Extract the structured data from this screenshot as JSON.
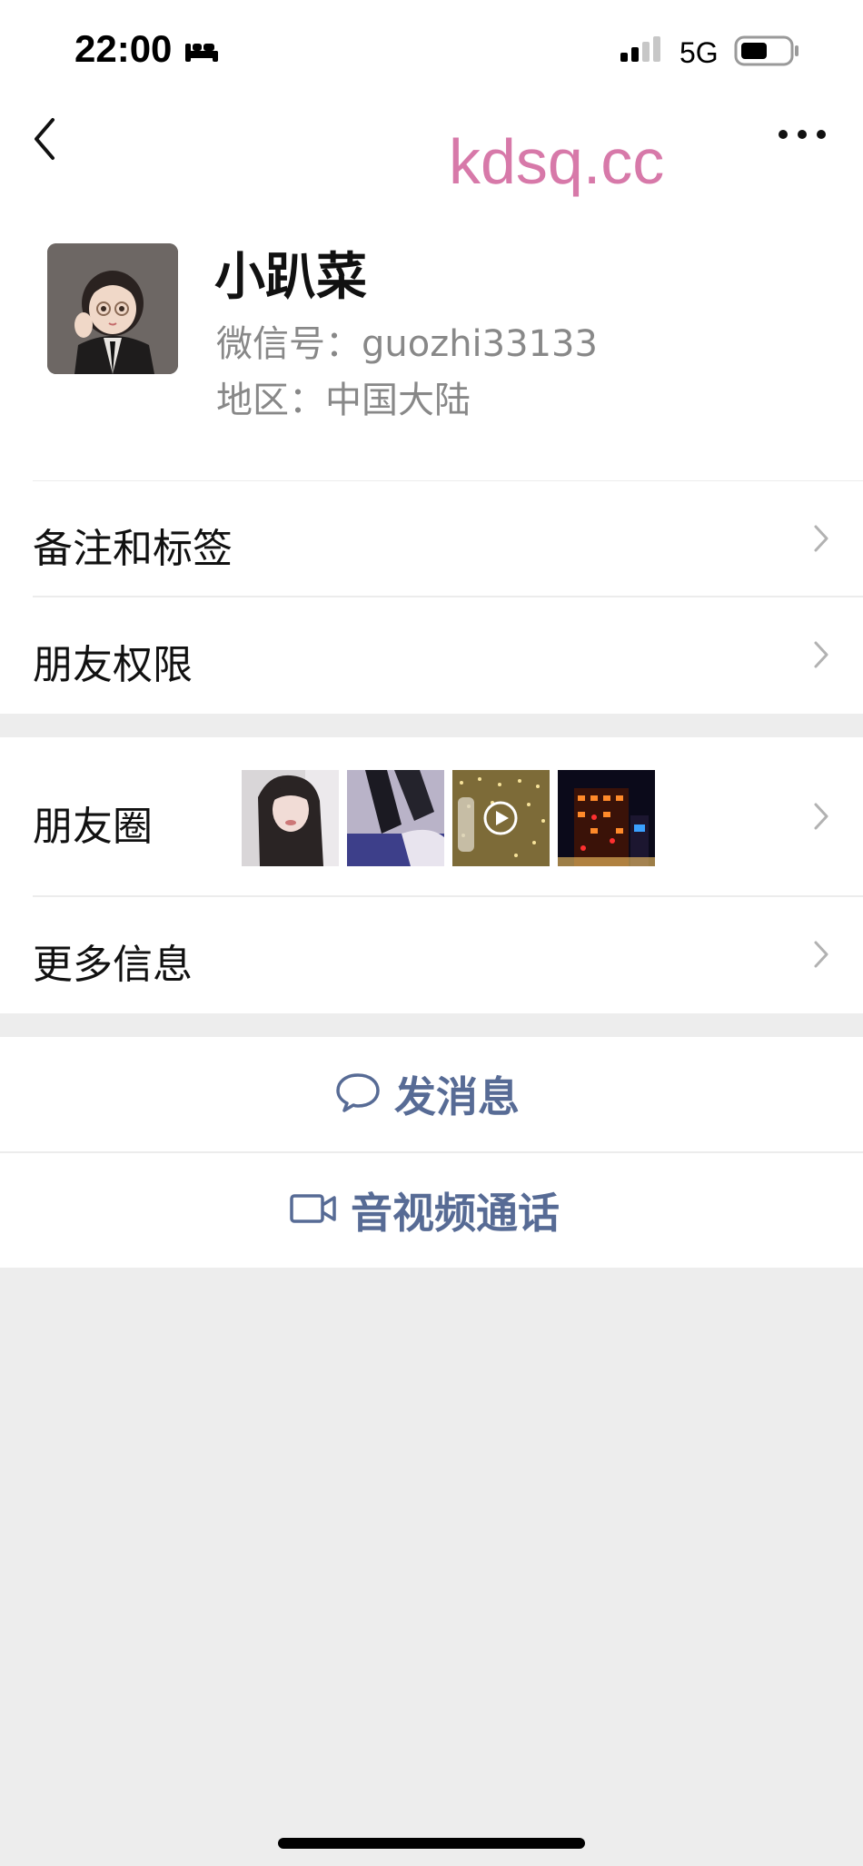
{
  "status_bar": {
    "time": "22:00",
    "network": "5G",
    "icons": [
      "sleep-icon",
      "signal-icon",
      "battery-icon"
    ]
  },
  "nav": {
    "back_icon": "chevron-left-icon",
    "watermark": "kdsq.cc",
    "more_icon": "more-icon"
  },
  "profile": {
    "name": "小趴菜",
    "wechat_id": "微信号：guozhi33133",
    "region": "地区：中国大陆"
  },
  "cells": {
    "remarks": "备注和标签",
    "permissions": "朋友权限",
    "moments": "朋友圈",
    "more_info": "更多信息"
  },
  "actions": {
    "message": "发消息",
    "call": "音视频通话"
  },
  "colors": {
    "link_blue": "#576b95",
    "watermark_pink": "#d779a9",
    "background": "#ededed"
  }
}
